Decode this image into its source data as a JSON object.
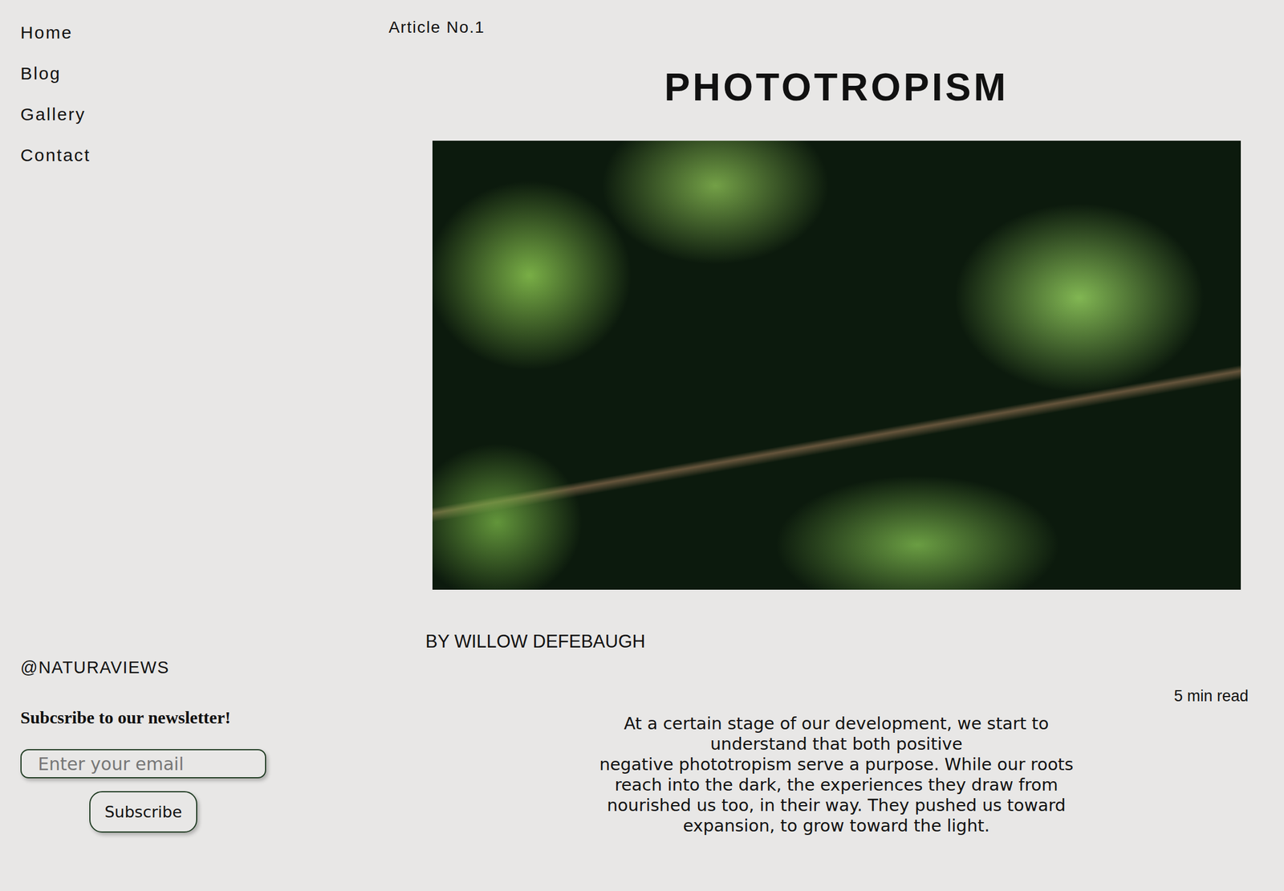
{
  "nav": {
    "items": [
      {
        "label": "Home"
      },
      {
        "label": "Blog"
      },
      {
        "label": "Gallery"
      },
      {
        "label": "Contact"
      }
    ]
  },
  "social": "@NATURAVIEWS",
  "newsletter": {
    "heading": "Subcsribe to our newsletter!",
    "placeholder": "Enter your email",
    "button": "Subscribe"
  },
  "article": {
    "number": "Article No.1",
    "title": "PHOTOTROPISM",
    "byline": "BY WILLOW DEFEBAUGH",
    "read_time": "5 min read",
    "lines": [
      "At a certain stage of our development, we start to",
      "understand that both positive",
      "negative phototropism serve a purpose. While our roots",
      "reach into the dark, the experiences they draw from",
      "nourished us too, in their way. They pushed us toward",
      "expansion, to grow toward the light."
    ]
  }
}
